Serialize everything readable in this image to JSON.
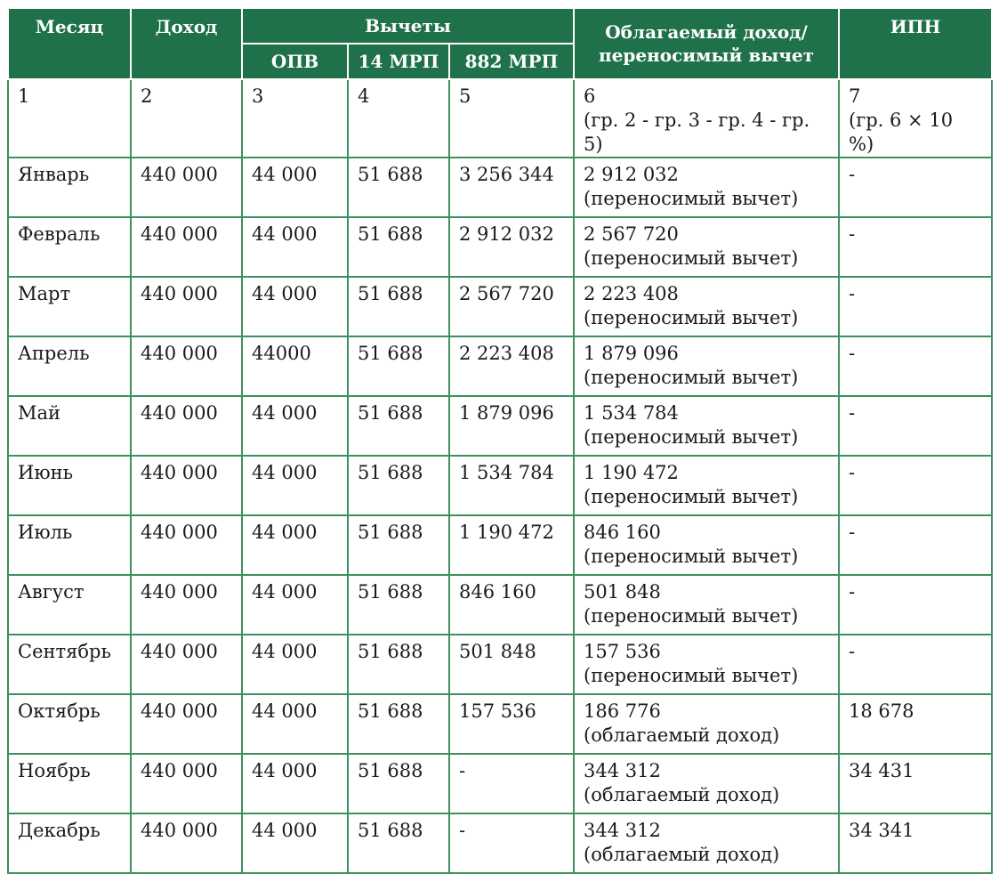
{
  "header": {
    "month": "Месяц",
    "income": "Доход",
    "deductions": "Вычеты",
    "opv": "ОПВ",
    "mrp14": "14 МРП",
    "mrp882": "882 МРП",
    "taxable_line1": "Облагаемый доход/",
    "taxable_line2": "переносимый вычет",
    "ipn": "ИПН"
  },
  "column_numbers": {
    "c1": "1",
    "c2": "2",
    "c3": "3",
    "c4": "4",
    "c5": "5",
    "c6": "6",
    "c6_formula": "(гр. 2 - гр. 3 - гр. 4 - гр. 5)",
    "c7": "7",
    "c7_formula": "(гр. 6 × 10 %)"
  },
  "rows": [
    {
      "month": "Январь",
      "income": "440 000",
      "opv": "44 000",
      "mrp14": "51 688",
      "mrp882": "3 256 344",
      "taxable": "2 912 032",
      "taxable_note": "(переносимый вычет)",
      "ipn": "-"
    },
    {
      "month": "Февраль",
      "income": "440 000",
      "opv": "44 000",
      "mrp14": "51 688",
      "mrp882": "2 912 032",
      "taxable": "2 567 720",
      "taxable_note": "(переносимый вычет)",
      "ipn": "-"
    },
    {
      "month": "Март",
      "income": "440 000",
      "opv": "44 000",
      "mrp14": "51 688",
      "mrp882": "2 567 720",
      "taxable": "2 223 408",
      "taxable_note": "(переносимый вычет)",
      "ipn": "-"
    },
    {
      "month": "Апрель",
      "income": "440 000",
      "opv": "44000",
      "mrp14": "51 688",
      "mrp882": "2 223 408",
      "taxable": "1 879 096",
      "taxable_note": "(переносимый вычет)",
      "ipn": "-"
    },
    {
      "month": "Май",
      "income": "440 000",
      "opv": "44 000",
      "mrp14": "51 688",
      "mrp882": "1 879 096",
      "taxable": "1 534 784",
      "taxable_note": "(переносимый вычет)",
      "ipn": "-"
    },
    {
      "month": "Июнь",
      "income": "440 000",
      "opv": "44 000",
      "mrp14": "51 688",
      "mrp882": "1 534 784",
      "taxable": "1 190 472",
      "taxable_note": "(переносимый вычет)",
      "ipn": "-"
    },
    {
      "month": "Июль",
      "income": "440 000",
      "opv": "44 000",
      "mrp14": "51 688",
      "mrp882": "1 190 472",
      "taxable": "846 160",
      "taxable_note": "(переносимый вычет)",
      "ipn": "-"
    },
    {
      "month": "Август",
      "income": "440 000",
      "opv": "44 000",
      "mrp14": "51 688",
      "mrp882": "846 160",
      "taxable": "501 848",
      "taxable_note": "(переносимый вычет)",
      "ipn": "-"
    },
    {
      "month": "Сентябрь",
      "income": "440 000",
      "opv": "44 000",
      "mrp14": "51 688",
      "mrp882": "501 848",
      "taxable": "157 536",
      "taxable_note": "(переносимый вычет)",
      "ipn": "-"
    },
    {
      "month": "Октябрь",
      "income": "440 000",
      "opv": "44 000",
      "mrp14": "51 688",
      "mrp882": "157 536",
      "taxable": "186 776",
      "taxable_note": "(облагаемый доход)",
      "ipn": "18 678"
    },
    {
      "month": "Ноябрь",
      "income": "440 000",
      "opv": "44 000",
      "mrp14": "51 688",
      "mrp882": "-",
      "taxable": "344 312",
      "taxable_note": "(облагаемый доход)",
      "ipn": "34 431"
    },
    {
      "month": "Декабрь",
      "income": "440 000",
      "opv": "44 000",
      "mrp14": "51 688",
      "mrp882": "-",
      "taxable": "344 312",
      "taxable_note": "(облагаемый доход)",
      "ipn": "34 341"
    }
  ]
}
